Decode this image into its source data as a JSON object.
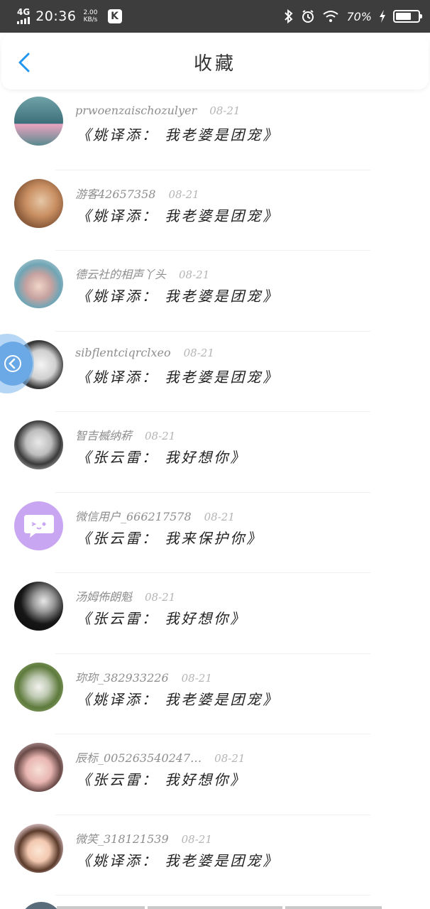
{
  "status_bar": {
    "network": "4G",
    "time": "20:36",
    "speed_value": "2.00",
    "speed_unit": "KB/s",
    "app_badge": "K",
    "battery_percent_text": "70%",
    "battery_level": 0.7
  },
  "header": {
    "title": "收藏",
    "back_icon": "chevron-left-icon",
    "accent_color": "#2196F3"
  },
  "favorites": [
    {
      "user": "prwoenzaischozulyer",
      "date": "08-21",
      "song": "《姚译添： 我老婆是团宠》"
    },
    {
      "user": "游客42657358",
      "date": "08-21",
      "song": "《姚译添： 我老婆是团宠》"
    },
    {
      "user": "德云社的相声丫头",
      "date": "08-21",
      "song": "《姚译添： 我老婆是团宠》"
    },
    {
      "user": "sibflentciqrclxeo",
      "date": "08-21",
      "song": "《姚译添： 我老婆是团宠》"
    },
    {
      "user": "智吉楲纳菥",
      "date": "08-21",
      "song": "《张云雷： 我好想你》"
    },
    {
      "user": "微信用户_666217578",
      "date": "08-21",
      "song": "《张云雷： 我来保护你》"
    },
    {
      "user": "汤姆佈朗魁",
      "date": "08-21",
      "song": "《张云雷： 我好想你》"
    },
    {
      "user": "珎珎_382933226",
      "date": "08-21",
      "song": "《姚译添： 我老婆是团宠》"
    },
    {
      "user": "辰标_005263540247…",
      "date": "08-21",
      "song": "《张云雷： 我好想你》"
    },
    {
      "user": "微笑_318121539",
      "date": "08-21",
      "song": "《姚译添： 我老婆是团宠》"
    }
  ]
}
